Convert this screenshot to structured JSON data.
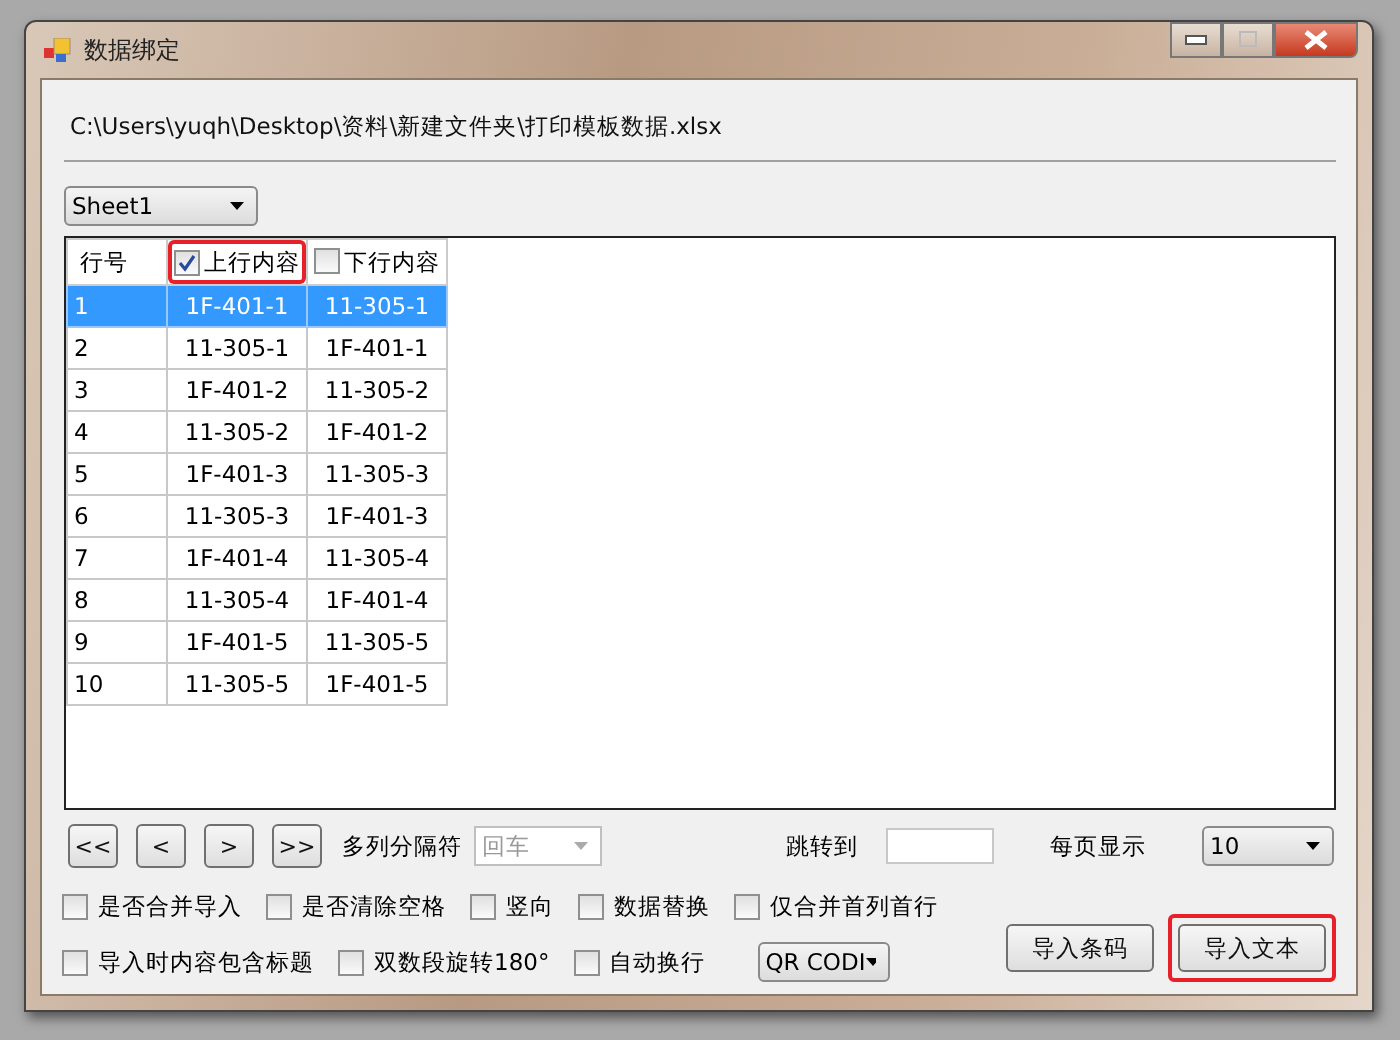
{
  "window": {
    "title": "数据绑定"
  },
  "file_path": "C:\\Users\\yuqh\\Desktop\\资料\\新建文件夹\\打印模板数据.xlsx",
  "sheet_select": {
    "value": "Sheet1"
  },
  "table": {
    "columns": [
      {
        "label": "行号",
        "kind": "text"
      },
      {
        "label": "上行内容",
        "kind": "checkbox",
        "checked": true,
        "highlighted": true
      },
      {
        "label": "下行内容",
        "kind": "checkbox",
        "checked": false,
        "highlighted": false
      }
    ],
    "rows": [
      {
        "cells": [
          "1",
          "1F-401-1",
          "11-305-1"
        ],
        "selected": true
      },
      {
        "cells": [
          "2",
          "11-305-1",
          "1F-401-1"
        ],
        "selected": false
      },
      {
        "cells": [
          "3",
          "1F-401-2",
          "11-305-2"
        ],
        "selected": false
      },
      {
        "cells": [
          "4",
          "11-305-2",
          "1F-401-2"
        ],
        "selected": false
      },
      {
        "cells": [
          "5",
          "1F-401-3",
          "11-305-3"
        ],
        "selected": false
      },
      {
        "cells": [
          "6",
          "11-305-3",
          "1F-401-3"
        ],
        "selected": false
      },
      {
        "cells": [
          "7",
          "1F-401-4",
          "11-305-4"
        ],
        "selected": false
      },
      {
        "cells": [
          "8",
          "11-305-4",
          "1F-401-4"
        ],
        "selected": false
      },
      {
        "cells": [
          "9",
          "1F-401-5",
          "11-305-5"
        ],
        "selected": false
      },
      {
        "cells": [
          "10",
          "11-305-5",
          "1F-401-5"
        ],
        "selected": false
      }
    ]
  },
  "pager": {
    "buttons": [
      "<<",
      "<",
      ">",
      ">>"
    ],
    "separator_label": "多列分隔符",
    "separator_select": {
      "value": "回车",
      "disabled": true
    },
    "goto_label": "跳转到",
    "page_size_label": "每页显示",
    "page_size_select": {
      "value": "10"
    }
  },
  "options": [
    [
      {
        "label": "是否合并导入",
        "checked": false
      },
      {
        "label": "是否清除空格",
        "checked": false
      },
      {
        "label": "竖向",
        "checked": false
      },
      {
        "label": "数据替换",
        "checked": false
      },
      {
        "label": "仅合并首列首行",
        "checked": false
      }
    ],
    [
      {
        "label": "导入时内容包含标题",
        "checked": false
      },
      {
        "label": "双数段旋转180°",
        "checked": false
      },
      {
        "label": "自动换行",
        "checked": false
      }
    ]
  ],
  "code_type_select": {
    "value": "QR CODI"
  },
  "actions": [
    {
      "label": "导入条码",
      "highlighted": false
    },
    {
      "label": "导入文本",
      "highlighted": true
    }
  ]
}
